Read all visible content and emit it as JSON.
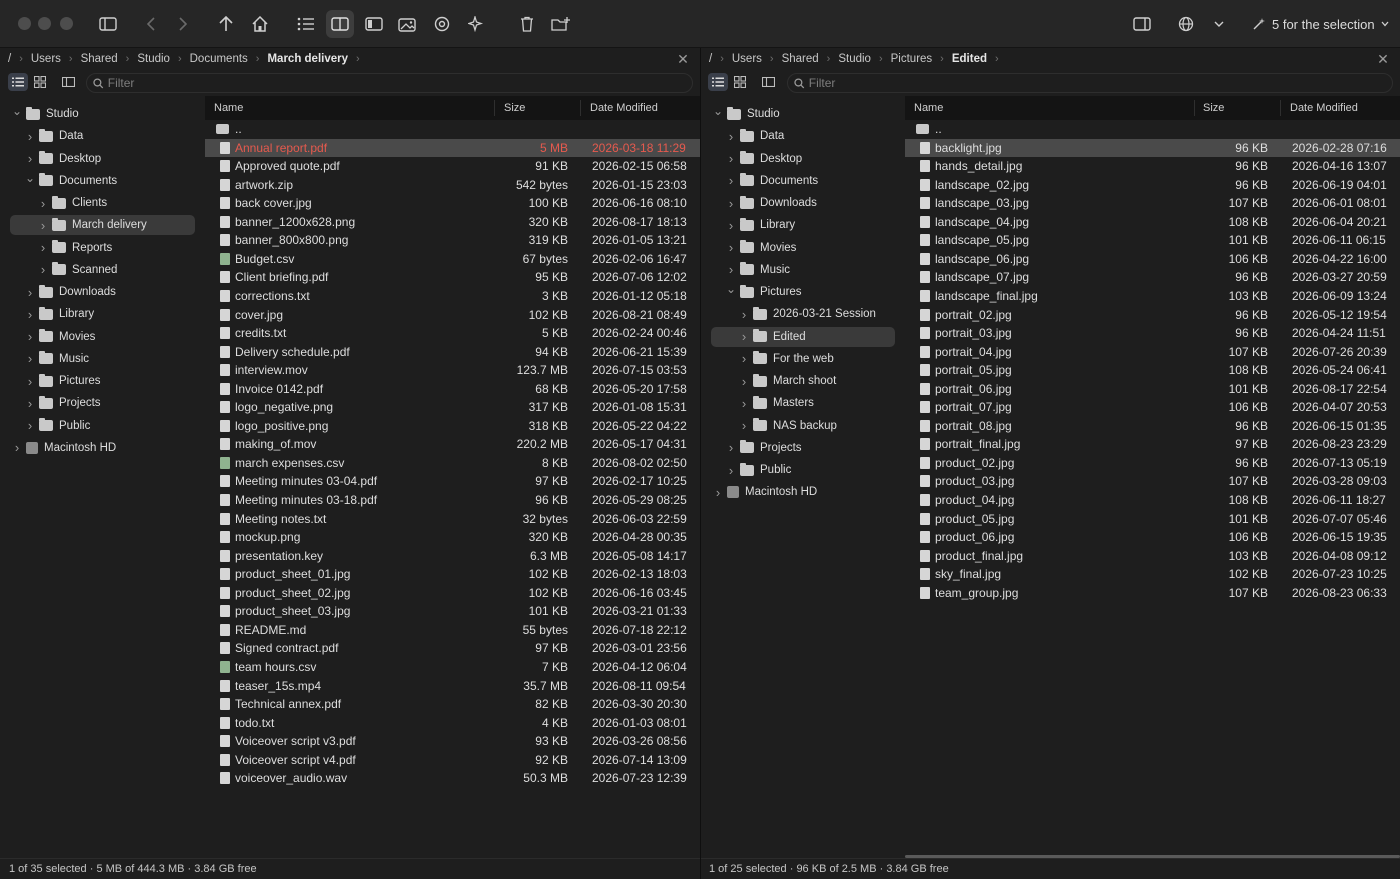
{
  "toolbar": {
    "selection_label": "5 for the selection"
  },
  "left": {
    "breadcrumbs": [
      "/",
      "Users",
      "Shared",
      "Studio",
      "Documents",
      "March delivery"
    ],
    "filter_placeholder": "Filter",
    "tree": [
      {
        "label": "Studio",
        "level": 0,
        "state": "open"
      },
      {
        "label": "Data",
        "level": 1,
        "state": "closed"
      },
      {
        "label": "Desktop",
        "level": 1,
        "state": "closed"
      },
      {
        "label": "Documents",
        "level": 1,
        "state": "open"
      },
      {
        "label": "Clients",
        "level": 2,
        "state": "closed"
      },
      {
        "label": "March delivery",
        "level": 2,
        "state": "closed",
        "selected": true
      },
      {
        "label": "Reports",
        "level": 2,
        "state": "closed"
      },
      {
        "label": "Scanned",
        "level": 2,
        "state": "closed"
      },
      {
        "label": "Downloads",
        "level": 1,
        "state": "closed"
      },
      {
        "label": "Library",
        "level": 1,
        "state": "closed"
      },
      {
        "label": "Movies",
        "level": 1,
        "state": "closed"
      },
      {
        "label": "Music",
        "level": 1,
        "state": "closed"
      },
      {
        "label": "Pictures",
        "level": 1,
        "state": "closed"
      },
      {
        "label": "Projects",
        "level": 1,
        "state": "closed"
      },
      {
        "label": "Public",
        "level": 1,
        "state": "closed"
      },
      {
        "label": "Macintosh HD",
        "level": 0,
        "state": "closed",
        "disk": true
      }
    ],
    "columns": {
      "name": "Name",
      "size": "Size",
      "date": "Date Modified"
    },
    "files": [
      {
        "name": "..",
        "size": "",
        "date": "",
        "kind": "parent"
      },
      {
        "name": "Annual report.pdf",
        "size": "5 MB",
        "date": "2026-03-18 11:29",
        "selected": true,
        "red": true
      },
      {
        "name": "Approved quote.pdf",
        "size": "91 KB",
        "date": "2026-02-15 06:58"
      },
      {
        "name": "artwork.zip",
        "size": "542 bytes",
        "date": "2026-01-15 23:03"
      },
      {
        "name": "back cover.jpg",
        "size": "100 KB",
        "date": "2026-06-16 08:10"
      },
      {
        "name": "banner_1200x628.png",
        "size": "320 KB",
        "date": "2026-08-17 18:13"
      },
      {
        "name": "banner_800x800.png",
        "size": "319 KB",
        "date": "2026-01-05 13:21"
      },
      {
        "name": "Budget.csv",
        "size": "67 bytes",
        "date": "2026-02-06 16:47",
        "kind": "sheet"
      },
      {
        "name": "Client briefing.pdf",
        "size": "95 KB",
        "date": "2026-07-06 12:02"
      },
      {
        "name": "corrections.txt",
        "size": "3 KB",
        "date": "2026-01-12 05:18"
      },
      {
        "name": "cover.jpg",
        "size": "102 KB",
        "date": "2026-08-21 08:49"
      },
      {
        "name": "credits.txt",
        "size": "5 KB",
        "date": "2026-02-24 00:46"
      },
      {
        "name": "Delivery schedule.pdf",
        "size": "94 KB",
        "date": "2026-06-21 15:39"
      },
      {
        "name": "interview.mov",
        "size": "123.7 MB",
        "date": "2026-07-15 03:53"
      },
      {
        "name": "Invoice 0142.pdf",
        "size": "68 KB",
        "date": "2026-05-20 17:58"
      },
      {
        "name": "logo_negative.png",
        "size": "317 KB",
        "date": "2026-01-08 15:31"
      },
      {
        "name": "logo_positive.png",
        "size": "318 KB",
        "date": "2026-05-22 04:22"
      },
      {
        "name": "making_of.mov",
        "size": "220.2 MB",
        "date": "2026-05-17 04:31"
      },
      {
        "name": "march expenses.csv",
        "size": "8 KB",
        "date": "2026-08-02 02:50",
        "kind": "sheet"
      },
      {
        "name": "Meeting minutes 03-04.pdf",
        "size": "97 KB",
        "date": "2026-02-17 10:25"
      },
      {
        "name": "Meeting minutes 03-18.pdf",
        "size": "96 KB",
        "date": "2026-05-29 08:25"
      },
      {
        "name": "Meeting notes.txt",
        "size": "32 bytes",
        "date": "2026-06-03 22:59"
      },
      {
        "name": "mockup.png",
        "size": "320 KB",
        "date": "2026-04-28 00:35"
      },
      {
        "name": "presentation.key",
        "size": "6.3 MB",
        "date": "2026-05-08 14:17"
      },
      {
        "name": "product_sheet_01.jpg",
        "size": "102 KB",
        "date": "2026-02-13 18:03"
      },
      {
        "name": "product_sheet_02.jpg",
        "size": "102 KB",
        "date": "2026-06-16 03:45"
      },
      {
        "name": "product_sheet_03.jpg",
        "size": "101 KB",
        "date": "2026-03-21 01:33"
      },
      {
        "name": "README.md",
        "size": "55 bytes",
        "date": "2026-07-18 22:12"
      },
      {
        "name": "Signed contract.pdf",
        "size": "97 KB",
        "date": "2026-03-01 23:56"
      },
      {
        "name": "team hours.csv",
        "size": "7 KB",
        "date": "2026-04-12 06:04",
        "kind": "sheet"
      },
      {
        "name": "teaser_15s.mp4",
        "size": "35.7 MB",
        "date": "2026-08-11 09:54"
      },
      {
        "name": "Technical annex.pdf",
        "size": "82 KB",
        "date": "2026-03-30 20:30"
      },
      {
        "name": "todo.txt",
        "size": "4 KB",
        "date": "2026-01-03 08:01"
      },
      {
        "name": "Voiceover script v3.pdf",
        "size": "93 KB",
        "date": "2026-03-26 08:56"
      },
      {
        "name": "Voiceover script v4.pdf",
        "size": "92 KB",
        "date": "2026-07-14 13:09"
      },
      {
        "name": "voiceover_audio.wav",
        "size": "50.3 MB",
        "date": "2026-07-23 12:39"
      }
    ],
    "status": "1 of 35 selected · 5 MB of 444.3 MB · 3.84 GB free"
  },
  "right": {
    "breadcrumbs": [
      "/",
      "Users",
      "Shared",
      "Studio",
      "Pictures",
      "Edited"
    ],
    "filter_placeholder": "Filter",
    "tree": [
      {
        "label": "Studio",
        "level": 0,
        "state": "open"
      },
      {
        "label": "Data",
        "level": 1,
        "state": "closed"
      },
      {
        "label": "Desktop",
        "level": 1,
        "state": "closed"
      },
      {
        "label": "Documents",
        "level": 1,
        "state": "closed"
      },
      {
        "label": "Downloads",
        "level": 1,
        "state": "closed"
      },
      {
        "label": "Library",
        "level": 1,
        "state": "closed"
      },
      {
        "label": "Movies",
        "level": 1,
        "state": "closed"
      },
      {
        "label": "Music",
        "level": 1,
        "state": "closed"
      },
      {
        "label": "Pictures",
        "level": 1,
        "state": "open"
      },
      {
        "label": "2026-03-21 Session",
        "level": 2,
        "state": "closed"
      },
      {
        "label": "Edited",
        "level": 2,
        "state": "closed",
        "selected": true
      },
      {
        "label": "For the web",
        "level": 2,
        "state": "closed"
      },
      {
        "label": "March shoot",
        "level": 2,
        "state": "closed"
      },
      {
        "label": "Masters",
        "level": 2,
        "state": "closed"
      },
      {
        "label": "NAS backup",
        "level": 2,
        "state": "closed"
      },
      {
        "label": "Projects",
        "level": 1,
        "state": "closed"
      },
      {
        "label": "Public",
        "level": 1,
        "state": "closed"
      },
      {
        "label": "Macintosh HD",
        "level": 0,
        "state": "closed",
        "disk": true
      }
    ],
    "columns": {
      "name": "Name",
      "size": "Size",
      "date": "Date Modified"
    },
    "files": [
      {
        "name": "..",
        "size": "",
        "date": "",
        "kind": "parent"
      },
      {
        "name": "backlight.jpg",
        "size": "96 KB",
        "date": "2026-02-28 07:16",
        "selected": true
      },
      {
        "name": "hands_detail.jpg",
        "size": "96 KB",
        "date": "2026-04-16 13:07"
      },
      {
        "name": "landscape_02.jpg",
        "size": "96 KB",
        "date": "2026-06-19 04:01"
      },
      {
        "name": "landscape_03.jpg",
        "size": "107 KB",
        "date": "2026-06-01 08:01"
      },
      {
        "name": "landscape_04.jpg",
        "size": "108 KB",
        "date": "2026-06-04 20:21"
      },
      {
        "name": "landscape_05.jpg",
        "size": "101 KB",
        "date": "2026-06-11 06:15"
      },
      {
        "name": "landscape_06.jpg",
        "size": "106 KB",
        "date": "2026-04-22 16:00"
      },
      {
        "name": "landscape_07.jpg",
        "size": "96 KB",
        "date": "2026-03-27 20:59"
      },
      {
        "name": "landscape_final.jpg",
        "size": "103 KB",
        "date": "2026-06-09 13:24"
      },
      {
        "name": "portrait_02.jpg",
        "size": "96 KB",
        "date": "2026-05-12 19:54"
      },
      {
        "name": "portrait_03.jpg",
        "size": "96 KB",
        "date": "2026-04-24 11:51"
      },
      {
        "name": "portrait_04.jpg",
        "size": "107 KB",
        "date": "2026-07-26 20:39"
      },
      {
        "name": "portrait_05.jpg",
        "size": "108 KB",
        "date": "2026-05-24 06:41"
      },
      {
        "name": "portrait_06.jpg",
        "size": "101 KB",
        "date": "2026-08-17 22:54"
      },
      {
        "name": "portrait_07.jpg",
        "size": "106 KB",
        "date": "2026-04-07 20:53"
      },
      {
        "name": "portrait_08.jpg",
        "size": "96 KB",
        "date": "2026-06-15 01:35"
      },
      {
        "name": "portrait_final.jpg",
        "size": "97 KB",
        "date": "2026-08-23 23:29"
      },
      {
        "name": "product_02.jpg",
        "size": "96 KB",
        "date": "2026-07-13 05:19"
      },
      {
        "name": "product_03.jpg",
        "size": "107 KB",
        "date": "2026-03-28 09:03"
      },
      {
        "name": "product_04.jpg",
        "size": "108 KB",
        "date": "2026-06-11 18:27"
      },
      {
        "name": "product_05.jpg",
        "size": "101 KB",
        "date": "2026-07-07 05:46"
      },
      {
        "name": "product_06.jpg",
        "size": "106 KB",
        "date": "2026-06-15 19:35"
      },
      {
        "name": "product_final.jpg",
        "size": "103 KB",
        "date": "2026-04-08 09:12"
      },
      {
        "name": "sky_final.jpg",
        "size": "102 KB",
        "date": "2026-07-23 10:25"
      },
      {
        "name": "team_group.jpg",
        "size": "107 KB",
        "date": "2026-08-23 06:33"
      }
    ],
    "status": "1 of 25 selected · 96 KB of 2.5 MB · 3.84 GB free"
  }
}
